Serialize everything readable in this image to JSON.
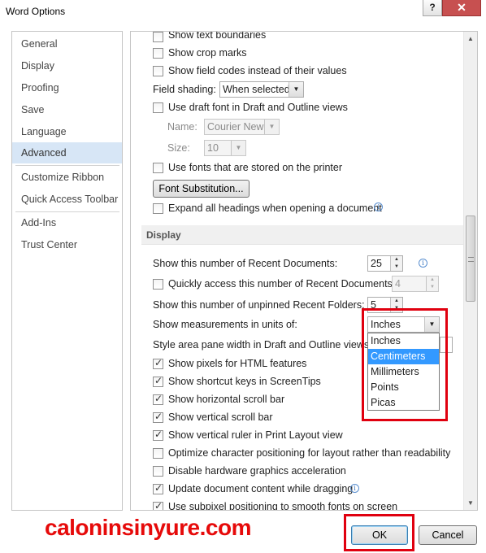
{
  "window": {
    "title": "Word Options",
    "help_label": "?",
    "close_label": "✕"
  },
  "nav": {
    "items": [
      {
        "label": "General"
      },
      {
        "label": "Display"
      },
      {
        "label": "Proofing"
      },
      {
        "label": "Save"
      },
      {
        "label": "Language"
      },
      {
        "label": "Advanced",
        "selected": true
      },
      {
        "label": "Customize Ribbon"
      },
      {
        "label": "Quick Access Toolbar"
      },
      {
        "label": "Add-Ins"
      },
      {
        "label": "Trust Center"
      }
    ]
  },
  "options_top": {
    "show_text_boundaries": {
      "label": "Show text boundaries",
      "checked": false
    },
    "show_crop_marks": {
      "label": "Show crop marks",
      "checked": false
    },
    "show_field_codes": {
      "label": "Show field codes instead of their values",
      "checked": false
    },
    "field_shading": {
      "label": "Field shading:",
      "value": "When selected"
    },
    "draft_font": {
      "label": "Use draft font in Draft and Outline views",
      "checked": false
    },
    "name": {
      "label": "Name:",
      "value": "Courier New"
    },
    "size": {
      "label": "Size:",
      "value": "10"
    },
    "printer_fonts": {
      "label": "Use fonts that are stored on the printer",
      "checked": false
    },
    "font_substitution_label": "Font Substitution...",
    "expand_headings": {
      "label": "Expand all headings when opening a document",
      "checked": false
    }
  },
  "display_section": {
    "header": "Display",
    "recent_documents": {
      "label": "Show this number of Recent Documents:",
      "value": "25"
    },
    "quick_access_recent": {
      "label": "Quickly access this number of Recent Documents:",
      "value": "4",
      "checked": false
    },
    "recent_folders": {
      "label": "Show this number of unpinned Recent Folders:",
      "value": "5"
    },
    "measurement_units": {
      "label": "Show measurements in units of:",
      "value": "Inches",
      "options": [
        "Inches",
        "Centimeters",
        "Millimeters",
        "Points",
        "Picas"
      ],
      "highlighted": "Centimeters"
    },
    "style_area_width": {
      "label": "Style area pane width in Draft and Outline views:"
    },
    "checkboxes": [
      {
        "label": "Show pixels for HTML features",
        "checked": true
      },
      {
        "label": "Show shortcut keys in ScreenTips",
        "checked": true
      },
      {
        "label": "Show horizontal scroll bar",
        "checked": true
      },
      {
        "label": "Show vertical scroll bar",
        "checked": true
      },
      {
        "label": "Show vertical ruler in Print Layout view",
        "checked": true
      },
      {
        "label": "Optimize character positioning for layout rather than readability",
        "checked": false
      },
      {
        "label": "Disable hardware graphics acceleration",
        "checked": false
      },
      {
        "label": "Update document content while dragging",
        "checked": true
      },
      {
        "label": "Use subpixel positioning to smooth fonts on screen",
        "checked": true
      }
    ]
  },
  "buttons": {
    "ok_label": "OK",
    "cancel_label": "Cancel"
  },
  "watermark": "caloninsinyure.com",
  "colors": {
    "nav_selected": "#d7e6f6",
    "highlight_red": "#e0000f",
    "selection_blue": "#3399ff",
    "watermark_red": "#e60a0a"
  }
}
